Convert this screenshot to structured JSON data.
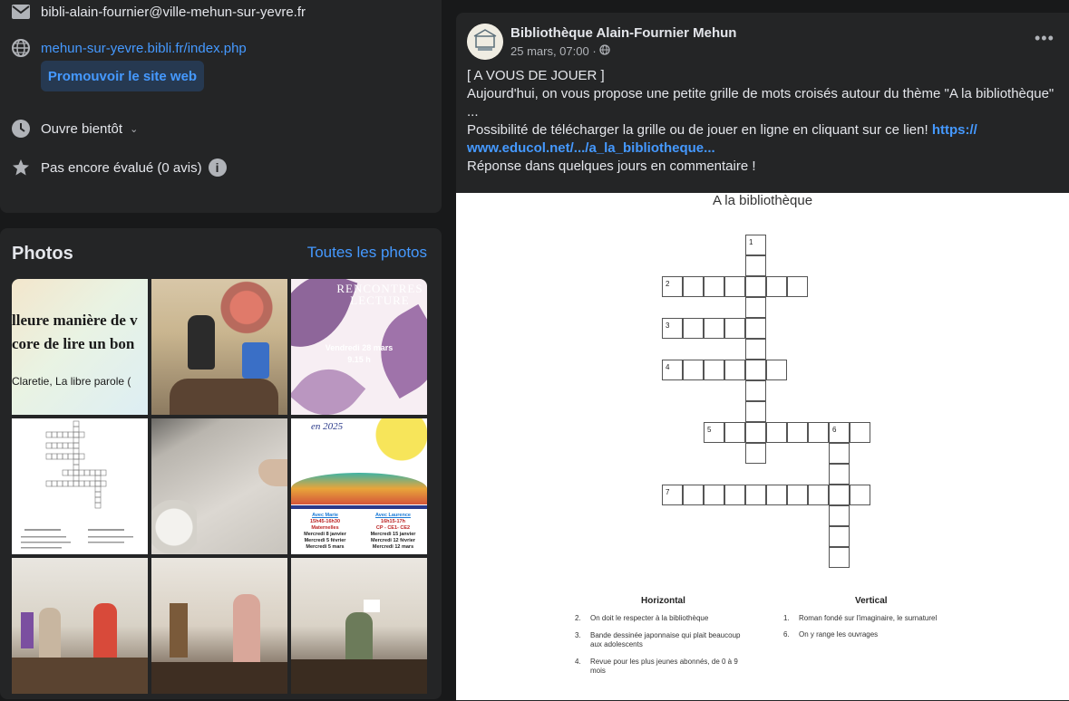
{
  "intro": {
    "email": "bibli-alain-fournier@ville-mehun-sur-yevre.fr",
    "website": "mehun-sur-yevre.bibli.fr/index.php",
    "promote_label": "Promouvoir le site web",
    "hours": "Ouvre bientôt",
    "rating": "Pas encore évalué (0 avis)"
  },
  "photos": {
    "title": "Photos",
    "all_label": "Toutes les photos",
    "thumb1_line1": "lleure manière de v",
    "thumb1_line2": "core de lire un bon",
    "thumb1_line3": "Claretie, La libre parole (",
    "thumb3_title": "RENCONTRES LECTURE",
    "thumb3_date": "Vendredi 28 mars",
    "thumb3_time": "9.15 h",
    "thumb6_year": "en 2025",
    "thumb6_col1": [
      "Avec Marie",
      "15h45-16h30",
      "Maternelles",
      "Mercredi 8 janvier",
      "Mercredi 5 février",
      "Mercredi 5 mars"
    ],
    "thumb6_col2": [
      "Avec Laurence",
      "16h15-17h",
      "CP - CE1- CE2",
      "Mercredi 15 janvier",
      "Mercredi 12 février",
      "Mercredi 12 mars"
    ]
  },
  "post": {
    "page_name": "Bibliothèque Alain-Fournier Mehun",
    "date": "25 mars, 07:00 ·",
    "line1": "[ A VOUS DE JOUER ]",
    "line2": "Aujourd'hui, on vous propose une petite grille de mots croisés autour du thème \"A la bibliothèque\"",
    "line3": "...",
    "line4": "Possibilité de télécharger la grille ou de jouer en ligne en cliquant sur ce lien! ",
    "link_part1": "https://",
    "link_part2": "www.educol.net/.../a_la_bibliotheque...",
    "line6": "Réponse dans quelques jours en commentaire !",
    "more": "•••"
  },
  "crossword": {
    "title": "A la bibliothèque",
    "numbers": [
      "1",
      "2",
      "3",
      "4",
      "5",
      "6",
      "7"
    ],
    "horizontal_title": "Horizontal",
    "vertical_title": "Vertical",
    "h_clues": [
      {
        "num": "2.",
        "text": "On doit le respecter à la bibliothèque"
      },
      {
        "num": "3.",
        "text": "Bande dessinée japonnaise qui plait beaucoup"
      },
      {
        "num": "",
        "text": "aux adolescents"
      },
      {
        "num": "4.",
        "text": "Revue pour les plus jeunes abonnés, de 0 à 9"
      },
      {
        "num": "",
        "text": "mois"
      }
    ],
    "v_clues": [
      {
        "num": "1.",
        "text": "Roman fondé sur l'imaginaire, le surnaturel"
      },
      {
        "num": "6.",
        "text": "On y range les ouvrages"
      }
    ]
  },
  "colors": {
    "bg": "#18191a",
    "card": "#242526",
    "link": "#4599ff",
    "text": "#e4e6eb",
    "muted": "#b0b3b8"
  }
}
